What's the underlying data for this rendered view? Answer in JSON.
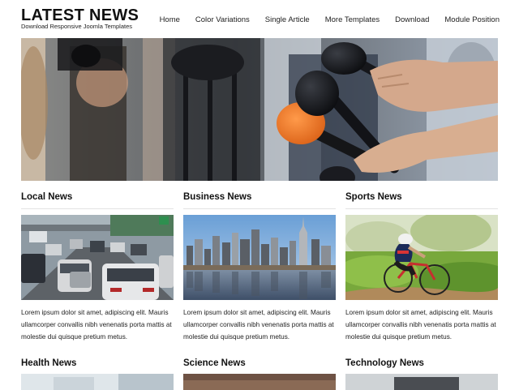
{
  "site": {
    "title": "LATEST NEWS",
    "subtitle": "Download Responsive Joomla Templates"
  },
  "nav": {
    "items": [
      "Home",
      "Color Variations",
      "Single Article",
      "More Templates",
      "Download",
      "Module Position"
    ]
  },
  "sections": [
    {
      "title": "Local News",
      "text": "Lorem ipsum dolor sit amet, adipiscing elit. Mauris ullamcorper convallis nibh venenatis porta mattis at molestie dui quisque pretium metus."
    },
    {
      "title": "Business News",
      "text": "Lorem ipsum dolor sit amet, adipiscing elit. Mauris ullamcorper convallis nibh venenatis porta mattis at molestie dui quisque pretium metus."
    },
    {
      "title": "Sports News",
      "text": "Lorem ipsum dolor sit amet, adipiscing elit. Mauris ullamcorper convallis nibh venenatis porta mattis at molestie dui quisque pretium metus."
    },
    {
      "title": "Health News"
    },
    {
      "title": "Science News"
    },
    {
      "title": "Technology News"
    }
  ],
  "colors": {
    "text": "#222222",
    "rule": "#e3e3e3",
    "mic_orange": "#f07a2c",
    "mic_black": "#15171c"
  }
}
